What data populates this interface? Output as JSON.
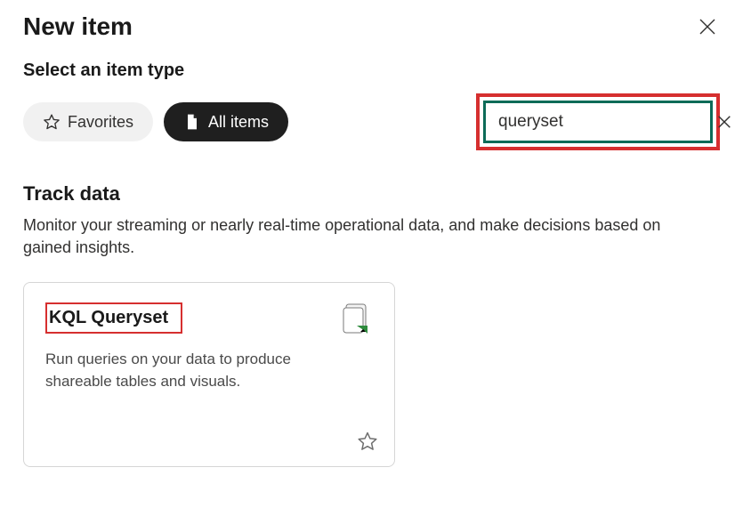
{
  "dialog": {
    "title": "New item",
    "subtitle": "Select an item type"
  },
  "filters": {
    "favorites_label": "Favorites",
    "all_items_label": "All items"
  },
  "search": {
    "value": "queryset",
    "placeholder": ""
  },
  "category": {
    "title": "Track data",
    "description": "Monitor your streaming or nearly real-time operational data, and make decisions based on gained insights."
  },
  "card": {
    "title": "KQL Queryset",
    "description": "Run queries on your data to produce shareable tables and visuals."
  }
}
